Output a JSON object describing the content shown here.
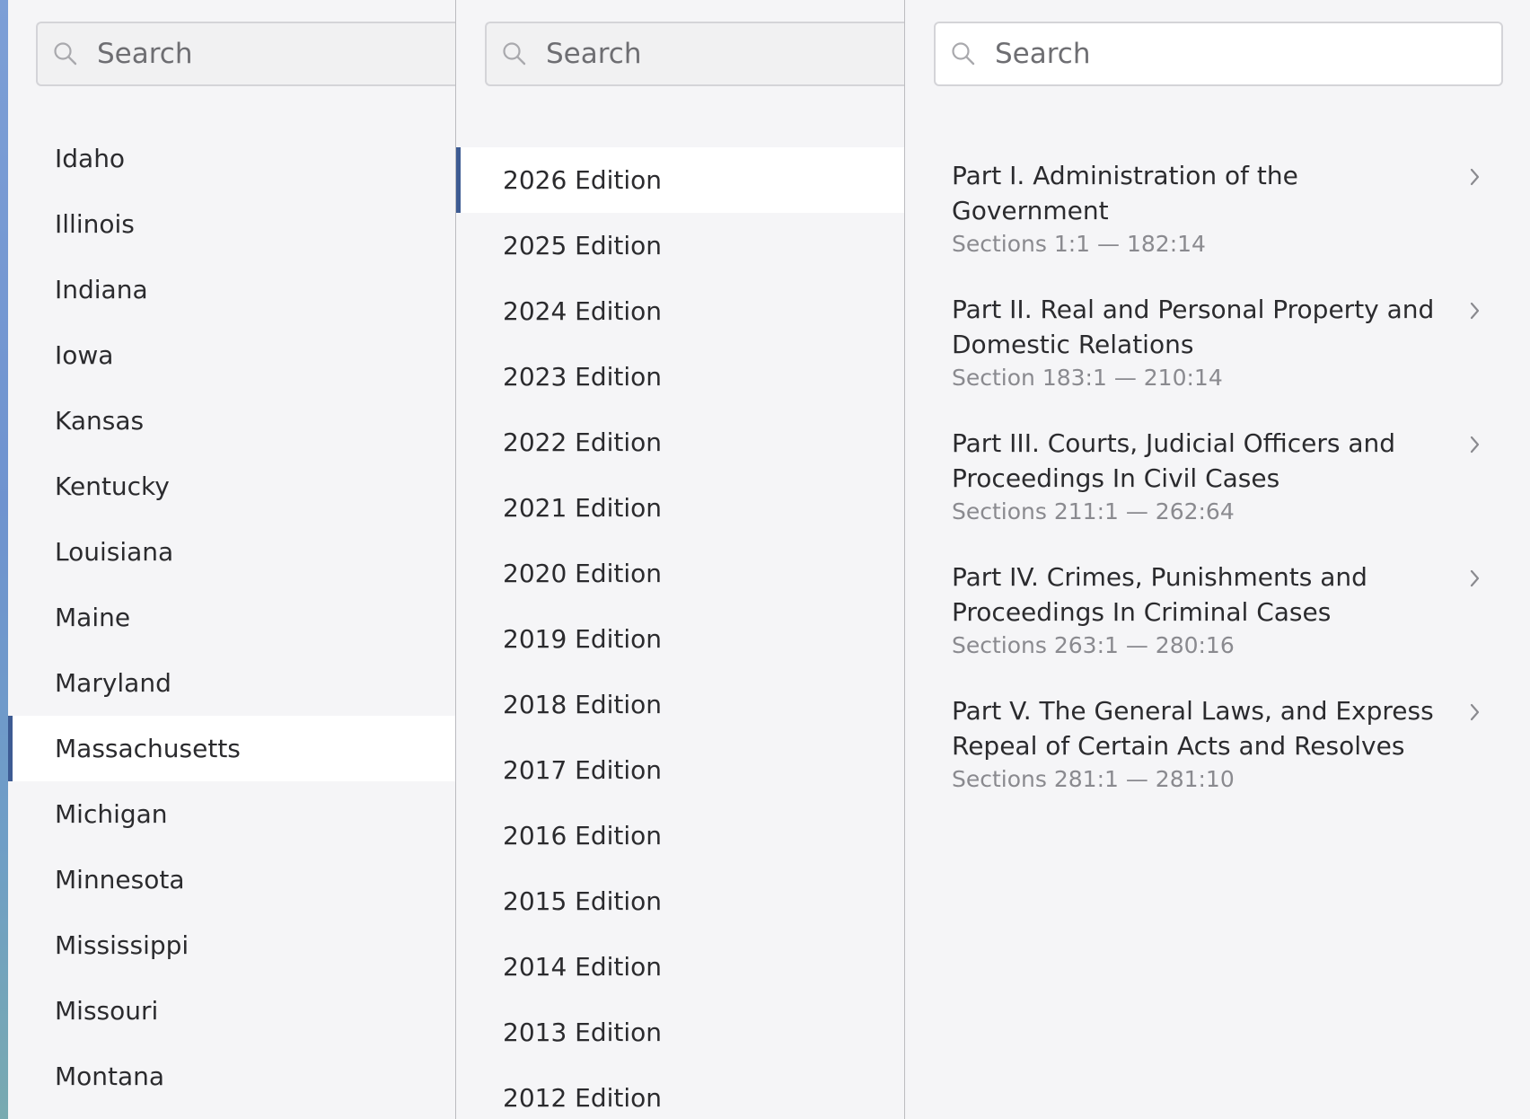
{
  "colors": {
    "accent": "#3d5b93",
    "selected_bg": "#ffffff",
    "pane_bg": "#f5f5f7",
    "secondary_text": "#8a8a8f"
  },
  "states_pane": {
    "search_placeholder": "Search",
    "items": [
      {
        "label": "Idaho"
      },
      {
        "label": "Illinois"
      },
      {
        "label": "Indiana"
      },
      {
        "label": "Iowa"
      },
      {
        "label": "Kansas"
      },
      {
        "label": "Kentucky"
      },
      {
        "label": "Louisiana"
      },
      {
        "label": "Maine"
      },
      {
        "label": "Maryland"
      },
      {
        "label": "Massachusetts"
      },
      {
        "label": "Michigan"
      },
      {
        "label": "Minnesota"
      },
      {
        "label": "Mississippi"
      },
      {
        "label": "Missouri"
      },
      {
        "label": "Montana"
      }
    ],
    "selected": "Massachusetts"
  },
  "editions_pane": {
    "search_placeholder": "Search",
    "items": [
      {
        "label": "2026 Edition"
      },
      {
        "label": "2025 Edition"
      },
      {
        "label": "2024 Edition"
      },
      {
        "label": "2023 Edition"
      },
      {
        "label": "2022 Edition"
      },
      {
        "label": "2021 Edition"
      },
      {
        "label": "2020 Edition"
      },
      {
        "label": "2019 Edition"
      },
      {
        "label": "2018 Edition"
      },
      {
        "label": "2017 Edition"
      },
      {
        "label": "2016 Edition"
      },
      {
        "label": "2015 Edition"
      },
      {
        "label": "2014 Edition"
      },
      {
        "label": "2013 Edition"
      },
      {
        "label": "2012 Edition"
      }
    ],
    "selected": "2026 Edition"
  },
  "parts_pane": {
    "search_placeholder": "Search",
    "items": [
      {
        "title": "Part I. Administration of the Government",
        "range": "Sections 1:1 — 182:14"
      },
      {
        "title": "Part II. Real and Personal Property and Domestic Relations",
        "range": "Section 183:1 — 210:14"
      },
      {
        "title": "Part III. Courts, Judicial Officers and Proceedings In Civil Cases",
        "range": "Sections 211:1 — 262:64"
      },
      {
        "title": "Part IV. Crimes, Punishments and Proceedings In Criminal Cases",
        "range": "Sections 263:1 — 280:16"
      },
      {
        "title": "Part V. The General Laws, and Express Repeal of Certain Acts and Resolves",
        "range": "Sections 281:1 — 281:10"
      }
    ],
    "item_icon": "chevron-right-icon",
    "search_icon": "search-icon"
  }
}
